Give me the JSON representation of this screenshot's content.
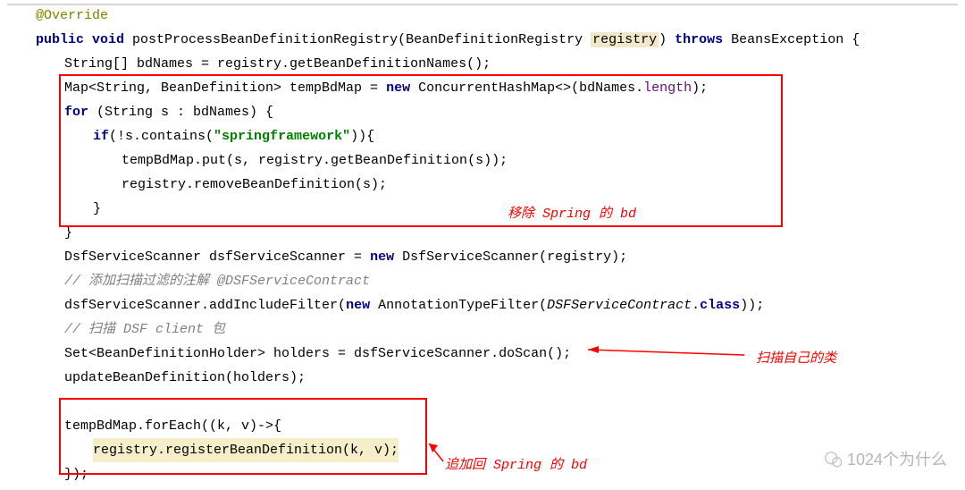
{
  "code": {
    "l0": "@Override",
    "l1_public": "public",
    "l1_void": " void",
    "l1_method": " postProcessBeanDefinitionRegistry(BeanDefinitionRegistry ",
    "l1_param": "registry",
    "l1_close": ") ",
    "l1_throws": "throws",
    "l1_exc": " BeansException {",
    "l2": "String[] bdNames = registry.getBeanDefinitionNames();",
    "l3a": "Map<String, BeanDefinition> tempBdMap = ",
    "l3_new": "new",
    "l3b": " ConcurrentHashMap<>(bdNames.",
    "l3_len": "length",
    "l3c": ");",
    "l4_for": "for",
    "l4b": " (String s : bdNames) {",
    "l5_if": "if",
    "l5b": "(!s.contains(",
    "l5_str": "\"springframework\"",
    "l5c": ")){",
    "l6": "tempBdMap.put(s, registry.getBeanDefinition(s));",
    "l7": "registry.removeBeanDefinition(s);",
    "l8": "}",
    "l9": "}",
    "l10a": "DsfServiceScanner dsfServiceScanner = ",
    "l10_new": "new",
    "l10b": " DsfServiceScanner(registry);",
    "l11": "// 添加扫描过滤的注解 @DSFServiceContract",
    "l12a": "dsfServiceScanner.addIncludeFilter(",
    "l12_new": "new",
    "l12b": " AnnotationTypeFilter(",
    "l12_cls": "DSFServiceContract",
    "l12c": ".",
    "l12_class": "class",
    "l12d": "));",
    "l13": "// 扫描 DSF client 包",
    "l14": "Set<BeanDefinitionHolder> holders = dsfServiceScanner.doScan();",
    "l15": "updateBeanDefinition(holders);",
    "l16": "",
    "l17": "tempBdMap.forEach((k, v)->{",
    "l18a": "registry",
    "l18b": ".registerBeanDefinition(k, v);",
    "l19": "});"
  },
  "annotations": {
    "remove": "移除 Spring 的 bd",
    "scan": "扫描自己的类",
    "append": "追加回 Spring 的 bd"
  },
  "watermark": "1024个为什么"
}
